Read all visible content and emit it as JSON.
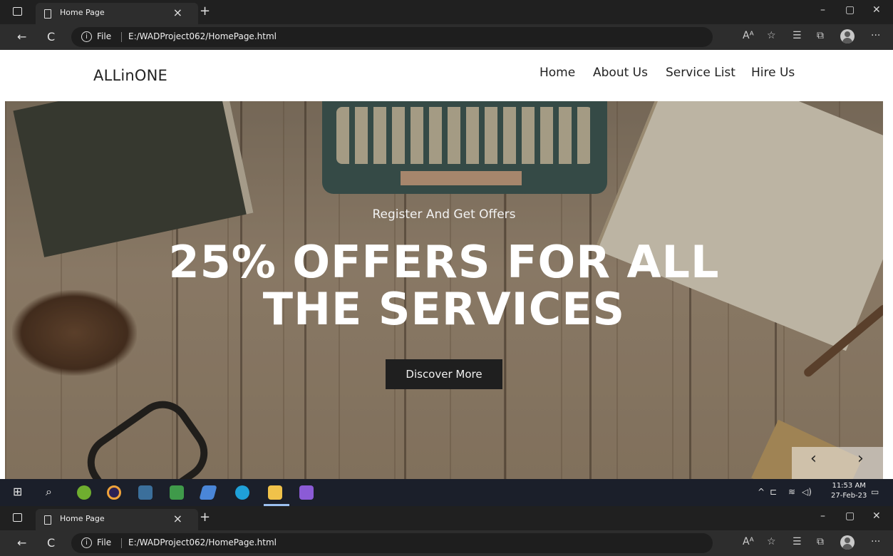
{
  "browser": {
    "tab_title": "Home Page",
    "tab_close": "×",
    "new_tab": "+",
    "window_controls": {
      "minimize": "–",
      "restore": "▢",
      "close": "✕"
    },
    "back": "←",
    "reload": "C",
    "address": {
      "file_label": "File",
      "url": "E:/WADProject062/HomePage.html"
    },
    "toolbar_icons": [
      "read-aloud-icon",
      "favorite-icon",
      "favorites-list-icon",
      "collections-icon",
      "profile-icon",
      "more-icon"
    ],
    "more_label": "···"
  },
  "site": {
    "brand": "ALLinONE",
    "nav": [
      "Home",
      "About Us",
      "Service List",
      "Hire Us"
    ]
  },
  "hero": {
    "subtitle": "Register And Get Offers",
    "title_line1": "25% OFFERS FOR ALL",
    "title_line2": "THE SERVICES",
    "cta": "Discover More",
    "prev": "‹",
    "next": "›"
  },
  "taskbar": {
    "time": "11:53 AM",
    "date": "27-Feb-23",
    "apps": [
      "start-icon",
      "search-icon",
      "app-green-icon",
      "eclipse-icon",
      "mysql-icon",
      "app-puzzle-icon",
      "app-blue-icon",
      "edge-icon",
      "file-explorer-icon",
      "visual-studio-icon"
    ],
    "tray": [
      "show-hidden-icon",
      "network-icon",
      "wifi-icon",
      "volume-icon",
      "notifications-icon"
    ]
  },
  "colors": {
    "accent_button": "#1f1f1f",
    "taskbar": "#1b1f2a",
    "chrome": "#202020"
  }
}
